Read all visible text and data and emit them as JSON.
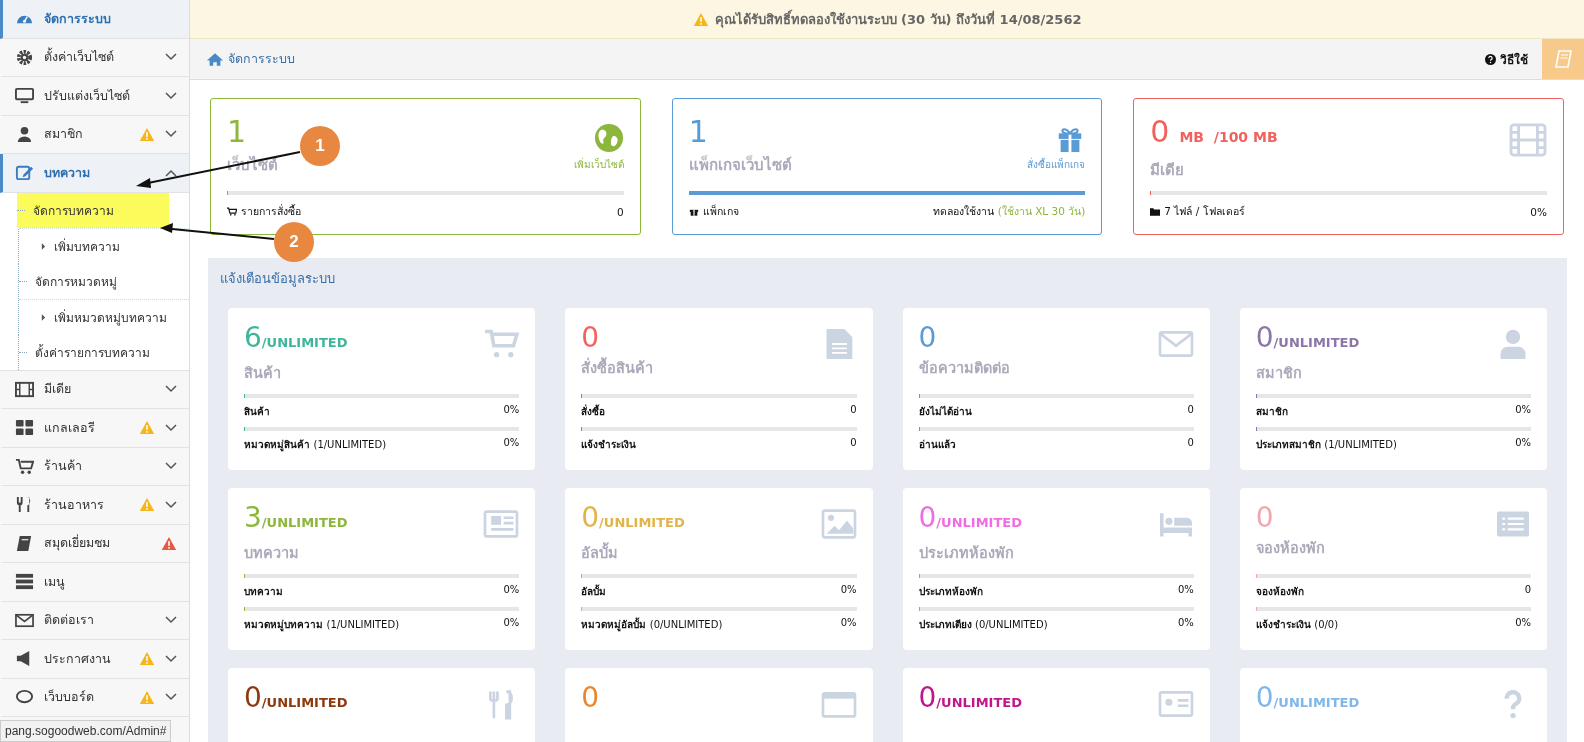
{
  "sidebar": {
    "items": [
      {
        "label": "จัดการระบบ",
        "selected": true,
        "kind": "plain"
      },
      {
        "label": "ตั้งค่าเว็บไซต์",
        "selected": false,
        "expanded": false,
        "kind": "plain"
      },
      {
        "label": "ปรับแต่งเว็บไซต์",
        "selected": false,
        "expanded": false,
        "kind": "plain"
      },
      {
        "label": "สมาชิก",
        "selected": false,
        "expanded": false,
        "kind": "warning"
      },
      {
        "label": "บทความ",
        "selected": true,
        "expanded": true,
        "kind": "plain",
        "children": [
          {
            "label": "จัดการบทความ",
            "selected": true,
            "children": [
              {
                "label": "เพิ่มบทความ",
                "selected": false
              }
            ]
          },
          {
            "label": "จัดการหมวดหมู่",
            "selected": false,
            "children": [
              {
                "label": "เพิ่มหมวดหมู่บทความ",
                "selected": false
              }
            ]
          },
          {
            "label": "ตั้งค่ารายการบทความ",
            "selected": false
          }
        ]
      },
      {
        "label": "มีเดีย",
        "selected": false,
        "expanded": false,
        "kind": "plain"
      },
      {
        "label": "แกลเลอรี",
        "selected": false,
        "expanded": false,
        "kind": "warning"
      },
      {
        "label": "ร้านค้า",
        "selected": false,
        "expanded": false,
        "kind": "plain"
      },
      {
        "label": "ร้านอาหาร",
        "selected": false,
        "expanded": false,
        "kind": "warning"
      },
      {
        "label": "สมุดเยี่ยมชม",
        "selected": false,
        "kind": "danger"
      },
      {
        "label": "เมนู",
        "selected": false,
        "kind": "plain"
      },
      {
        "label": "ติดต่อเรา",
        "selected": false,
        "expanded": false,
        "kind": "plain"
      },
      {
        "label": "ประกาศงาน",
        "selected": false,
        "expanded": false,
        "kind": "warning"
      },
      {
        "label": "เว็บบอร์ด",
        "selected": false,
        "expanded": false,
        "kind": "warning"
      }
    ]
  },
  "notice": "คุณได้รับสิทธิ์ทดลองใช้งานระบบ (30 วัน) ถึงวันที่ 14/08/2562",
  "breadcrumb": "จัดการระบบ",
  "help_link": "วิธีใช้",
  "summary_cards": [
    {
      "value": "1",
      "title": "เว็บไซต์",
      "color": "#8cb63c",
      "action": "เพิ่มเว็บไซต์",
      "level": 0,
      "footer_label": "รายการสั่งซื้อ",
      "footer_value": "0"
    },
    {
      "value": "1",
      "title": "แพ็กเกจเว็บไซต์",
      "color": "#5b9bd5",
      "action": "สั่งซื้อแพ็กเกจ",
      "level": 1,
      "footer_label": "แพ็กเกจ",
      "footer_value": "ทดลองใช้งาน",
      "footer_note": "(ใช้งาน XL 30 วัน)"
    },
    {
      "value": "0",
      "unit": "MB  /100 MB",
      "title": "มีเดีย",
      "color": "#f0625e",
      "level": 0,
      "footer_label": "7 ไฟล์ / โฟลเดอร์",
      "footer_value": "0%"
    }
  ],
  "panel": {
    "title": "แจ้งเตือนข้อมูลระบบ",
    "cards": [
      {
        "value": "6",
        "suffix": "/UNLIMITED",
        "title": "สินค้า",
        "color": "#3fb59a",
        "rows": [
          {
            "label": "สินค้า",
            "value": "0%",
            "level": 0
          },
          {
            "label": "หมวดหมู่สินค้า",
            "note": "(1/UNLIMITED)",
            "value": "0%",
            "level": 0
          }
        ]
      },
      {
        "value": "0",
        "title": "สั่งซื้อสินค้า",
        "color": "#f0625e",
        "rows": [
          {
            "label": "สั่งซื้อ",
            "value": "0",
            "level": 0
          },
          {
            "label": "แจ้งชำระเงิน",
            "value": "0",
            "level": 0
          }
        ]
      },
      {
        "value": "0",
        "title": "ข้อความติดต่อ",
        "color": "#5b9bd5",
        "rows": [
          {
            "label": "ยังไม่ได้อ่าน",
            "value": "0",
            "level": 0
          },
          {
            "label": "อ่านแล้ว",
            "value": "0",
            "level": 0
          }
        ]
      },
      {
        "value": "0",
        "suffix": "/UNLIMITED",
        "title": "สมาชิก",
        "color": "#8a76a8",
        "rows": [
          {
            "label": "สมาชิก",
            "value": "0%",
            "level": 0
          },
          {
            "label": "ประเภทสมาชิก",
            "note": "(1/UNLIMITED)",
            "value": "0%",
            "level": 0
          }
        ]
      },
      {
        "value": "3",
        "suffix": "/UNLIMITED",
        "title": "บทความ",
        "color": "#8cb63c",
        "rows": [
          {
            "label": "บทความ",
            "value": "0%",
            "level": 0
          },
          {
            "label": "หมวดหมู่บทความ",
            "note": "(1/UNLIMITED)",
            "value": "0%",
            "level": 0
          }
        ]
      },
      {
        "value": "0",
        "suffix": "/UNLIMITED",
        "title": "อัลบั้ม",
        "color": "#e0b44a",
        "rows": [
          {
            "label": "อัลบั้ม",
            "value": "0%",
            "level": 0
          },
          {
            "label": "หมวดหมู่อัลบั้ม",
            "note": "(0/UNLIMITED)",
            "value": "0%",
            "level": 0
          }
        ]
      },
      {
        "value": "0",
        "suffix": "/UNLIMITED",
        "title": "ประเภทห้องพัก",
        "color": "#f06ce0",
        "rows": [
          {
            "label": "ประเภทห้องพัก",
            "value": "0%",
            "level": 0
          },
          {
            "label": "ประเภทเตียง",
            "note": "(0/UNLIMITED)",
            "value": "0%",
            "level": 0
          }
        ]
      },
      {
        "value": "0",
        "title": "จองห้องพัก",
        "color": "#f4a6b0",
        "rows": [
          {
            "label": "จองห้องพัก",
            "value": "0",
            "level": 0
          },
          {
            "label": "แจ้งชำระเงิน",
            "note": "(0/0)",
            "value": "0%",
            "level": 0
          }
        ]
      },
      {
        "value": "0",
        "suffix": "/UNLIMITED",
        "color": "#8b3a0e"
      },
      {
        "value": "0",
        "color": "#e8872c"
      },
      {
        "value": "0",
        "suffix": "/UNLIMITED",
        "color": "#c0168a"
      },
      {
        "value": "0",
        "suffix": "/UNLIMITED",
        "color": "#7fb7e8"
      }
    ]
  },
  "annotations": [
    {
      "label": "1"
    },
    {
      "label": "2"
    }
  ],
  "status_url": "pang.sogoodweb.com/Admin#"
}
